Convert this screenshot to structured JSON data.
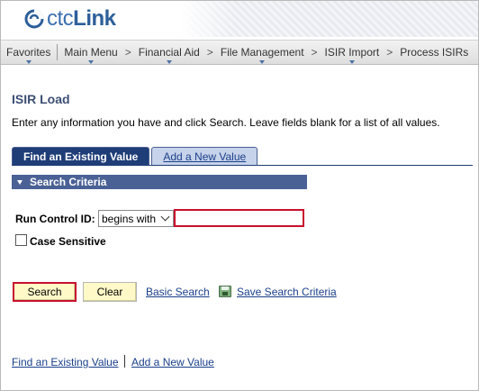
{
  "header": {
    "logo_prefix": "ctc",
    "logo_suffix": "Link"
  },
  "menubar": {
    "items": [
      {
        "label": "Favorites",
        "has_dropdown": true
      },
      {
        "label": "Main Menu",
        "has_dropdown": true
      },
      {
        "label": "Financial Aid",
        "has_dropdown": true
      },
      {
        "label": "File Management",
        "has_dropdown": true
      },
      {
        "label": "ISIR Import",
        "has_dropdown": true
      },
      {
        "label": "Process ISIRs",
        "has_dropdown": false
      }
    ],
    "breadcrumb_separator": ">"
  },
  "page": {
    "title": "ISIR Load",
    "instructions": "Enter any information you have and click Search. Leave fields blank for a list of all values."
  },
  "tabs": [
    {
      "label": "Find an Existing Value",
      "active": true
    },
    {
      "label": "Add a New Value",
      "active": false
    }
  ],
  "criteria": {
    "section_label": "Search Criteria",
    "run_control_label": "Run Control ID:",
    "operator_selected": "begins with",
    "run_control_value": "",
    "case_sensitive_label": "Case Sensitive",
    "case_sensitive_checked": false
  },
  "actions": {
    "search_label": "Search",
    "clear_label": "Clear",
    "basic_search_label": "Basic Search",
    "save_criteria_label": "Save Search Criteria"
  },
  "footer": {
    "find_label": "Find an Existing Value",
    "add_label": "Add a New Value"
  },
  "colors": {
    "brand": "#2d5f9a",
    "tab_active": "#1f3d77",
    "section_bar": "#4a6196",
    "button_bg": "#fff9c8",
    "highlight": "#c8102e",
    "link": "#1a3f8a"
  }
}
